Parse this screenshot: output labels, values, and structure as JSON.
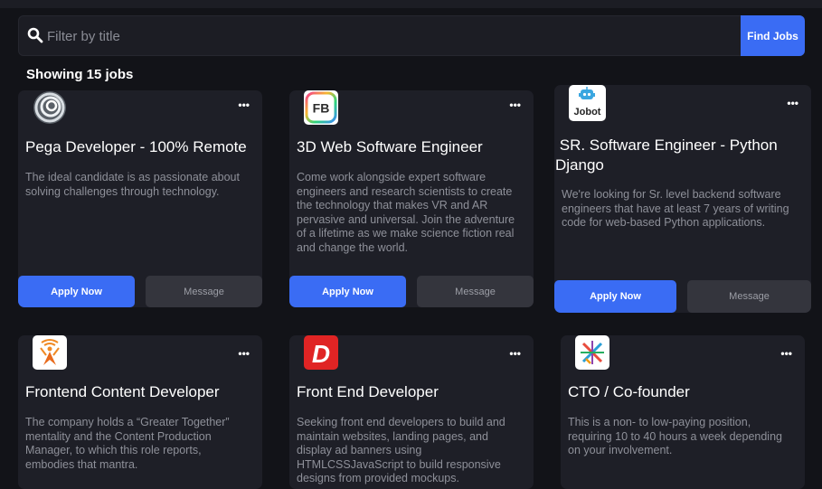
{
  "search": {
    "placeholder": "Filter by title",
    "button_label": "Find Jobs"
  },
  "results": {
    "count_label": "Showing 15 jobs"
  },
  "jobs": [
    {
      "logo": "pega-swirl-logo",
      "title": "Pega Developer - 100% Remote",
      "description": "The ideal candidate is as passionate about solving challenges through technology.",
      "apply_label": "Apply Now",
      "message_label": "Message",
      "menu_icon": "more-dots-icon"
    },
    {
      "logo": "fb-logo",
      "logo_text": "FB",
      "title": "3D Web Software Engineer",
      "description": "Come work alongside expert software engineers and research scientists to create the technology that makes VR and AR pervasive and universal. Join the adventure of a lifetime as we make science fiction real and change the world.",
      "apply_label": "Apply Now",
      "message_label": "Message",
      "menu_icon": "more-dots-icon"
    },
    {
      "logo": "jobot-robot-logo",
      "logo_text": "Jobot",
      "title": " SR. Software Engineer - Python Django",
      "description": "We're looking for Sr. level backend software engineers that have at least 7 years of writing code for web-based Python applications.",
      "apply_label": "Apply Now",
      "message_label": "Message",
      "menu_icon": "more-dots-icon"
    },
    {
      "logo": "signal-person-logo",
      "title": "Frontend Content Developer",
      "description": "The company holds a “Greater Together” mentality and the Content Production Manager, to which this role reports, embodies that mantra.",
      "menu_icon": "more-dots-icon"
    },
    {
      "logo": "d-letter-logo",
      "logo_text": "D",
      "title": "Front End Developer",
      "description": "Seeking front end developers to build and maintain websites, landing pages, and display ad banners using HTMLCSSJavaScript to build responsive designs from provided mockups.",
      "menu_icon": "more-dots-icon"
    },
    {
      "logo": "colorful-x-logo",
      "title": "CTO / Co-founder",
      "description": "This is a non- to low-paying position, requiring 10 to 40 hours a week depending on your involvement.",
      "menu_icon": "more-dots-icon"
    }
  ],
  "colors": {
    "background": "#121318",
    "card": "#1e1f27",
    "accent": "#3a6cf4",
    "secondary_button": "#34353d"
  }
}
